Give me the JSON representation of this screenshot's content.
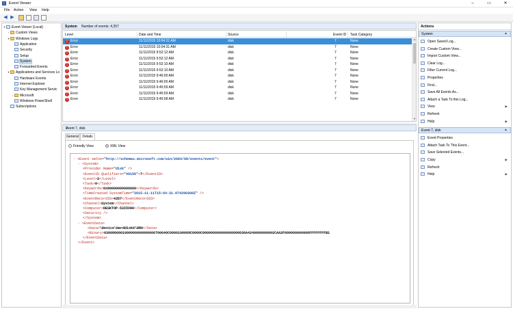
{
  "window": {
    "title": "Event Viewer",
    "minimize": "–",
    "maximize": "▭",
    "close": "✕"
  },
  "menu": [
    "File",
    "Action",
    "View",
    "Help"
  ],
  "toolbar_icons": [
    "back-arrow-icon",
    "forward-arrow-icon",
    "folder-icon",
    "properties-icon",
    "help-icon",
    "console-icon"
  ],
  "tree": [
    {
      "label": "Event Viewer (Local)",
      "indent": 0,
      "exp": "▾",
      "icon": "log"
    },
    {
      "label": "Custom Views",
      "indent": 1,
      "exp": "›",
      "icon": "folder"
    },
    {
      "label": "Windows Logs",
      "indent": 1,
      "exp": "▾",
      "icon": "folder"
    },
    {
      "label": "Application",
      "indent": 2,
      "exp": "",
      "icon": "log"
    },
    {
      "label": "Security",
      "indent": 2,
      "exp": "",
      "icon": "log"
    },
    {
      "label": "Setup",
      "indent": 2,
      "exp": "",
      "icon": "log"
    },
    {
      "label": "System",
      "indent": 2,
      "exp": "",
      "icon": "log",
      "selected": true
    },
    {
      "label": "Forwarded Events",
      "indent": 2,
      "exp": "",
      "icon": "log"
    },
    {
      "label": "Applications and Services Lo",
      "indent": 1,
      "exp": "▾",
      "icon": "folder"
    },
    {
      "label": "Hardware Events",
      "indent": 2,
      "exp": "",
      "icon": "log"
    },
    {
      "label": "Internet Explorer",
      "indent": 2,
      "exp": "",
      "icon": "log"
    },
    {
      "label": "Key Management Servic",
      "indent": 2,
      "exp": "",
      "icon": "log"
    },
    {
      "label": "Microsoft",
      "indent": 2,
      "exp": "›",
      "icon": "folder"
    },
    {
      "label": "Windows PowerShell",
      "indent": 2,
      "exp": "",
      "icon": "log"
    },
    {
      "label": "Subscriptions",
      "indent": 1,
      "exp": "",
      "icon": "log"
    }
  ],
  "list_header": {
    "name": "System",
    "count": "Number of events: 4,357"
  },
  "columns": [
    "Level",
    "Date and Time",
    "Source",
    "Event ID",
    "Task Category"
  ],
  "rows": [
    {
      "level": "Error",
      "date": "11/11/2015 10:04:31 AM",
      "source": "disk",
      "id": "7",
      "task": "None",
      "selected": true
    },
    {
      "level": "Error",
      "date": "11/11/2015 10:04:31 AM",
      "source": "disk",
      "id": "7",
      "task": "None"
    },
    {
      "level": "Error",
      "date": "11/11/2015 9:52:12 AM",
      "source": "disk",
      "id": "7",
      "task": "None"
    },
    {
      "level": "Error",
      "date": "11/11/2015 9:52:12 AM",
      "source": "disk",
      "id": "7",
      "task": "None"
    },
    {
      "level": "Error",
      "date": "11/11/2015 9:52:10 AM",
      "source": "disk",
      "id": "7",
      "task": "None"
    },
    {
      "level": "Error",
      "date": "11/11/2015 9:52:10 AM",
      "source": "disk",
      "id": "7",
      "task": "None"
    },
    {
      "level": "Error",
      "date": "11/11/2015 9:46:00 AM",
      "source": "disk",
      "id": "7",
      "task": "None"
    },
    {
      "level": "Error",
      "date": "11/11/2015 9:46:00 AM",
      "source": "disk",
      "id": "7",
      "task": "None"
    },
    {
      "level": "Error",
      "date": "11/11/2015 9:45:59 AM",
      "source": "disk",
      "id": "7",
      "task": "None"
    },
    {
      "level": "Error",
      "date": "11/11/2015 9:45:59 AM",
      "source": "disk",
      "id": "7",
      "task": "None"
    },
    {
      "level": "Error",
      "date": "11/11/2015 9:45:58 AM",
      "source": "disk",
      "id": "7",
      "task": "None"
    }
  ],
  "detail": {
    "title": "Event 7, disk",
    "close": "✕",
    "tabs": [
      "General",
      "Details"
    ],
    "radio_friendly": "Friendly View",
    "radio_xml": "XML View"
  },
  "xml_lines": [
    {
      "indent": 0,
      "parts": [
        [
          "minus",
          "- "
        ],
        [
          "tag",
          "<Event xmlns="
        ],
        [
          "val",
          "\"http://schemas.microsoft.com/win/2004/08/events/event\""
        ],
        [
          "tag",
          ">"
        ]
      ]
    },
    {
      "indent": 1,
      "parts": [
        [
          "minus",
          "- "
        ],
        [
          "tag",
          "<System>"
        ]
      ]
    },
    {
      "indent": 2,
      "parts": [
        [
          "tag",
          "<Provider Name="
        ],
        [
          "val",
          "\"disk\""
        ],
        [
          "tag",
          " />"
        ]
      ]
    },
    {
      "indent": 2,
      "parts": [
        [
          "tag",
          "<EventID Qualifiers="
        ],
        [
          "val",
          "\"49156\""
        ],
        [
          "tag",
          ">"
        ],
        [
          "txt",
          "7"
        ],
        [
          "tag",
          "</EventID>"
        ]
      ]
    },
    {
      "indent": 2,
      "parts": [
        [
          "tag",
          "<Level>"
        ],
        [
          "txt",
          "2"
        ],
        [
          "tag",
          "</Level>"
        ]
      ]
    },
    {
      "indent": 2,
      "parts": [
        [
          "tag",
          "<Task>"
        ],
        [
          "txt",
          "0"
        ],
        [
          "tag",
          "</Task>"
        ]
      ]
    },
    {
      "indent": 2,
      "parts": [
        [
          "tag",
          "<Keywords>"
        ],
        [
          "txt",
          "0x80000000000000"
        ],
        [
          "tag",
          "</Keywords>"
        ]
      ]
    },
    {
      "indent": 2,
      "parts": [
        [
          "tag",
          "<TimeCreated SystemTime="
        ],
        [
          "val",
          "\"2015-11-11T15:04:31.874290300Z\""
        ],
        [
          "tag",
          " />"
        ]
      ]
    },
    {
      "indent": 2,
      "parts": [
        [
          "tag",
          "<EventRecordID>"
        ],
        [
          "txt",
          "4357"
        ],
        [
          "tag",
          "</EventRecordID>"
        ]
      ]
    },
    {
      "indent": 2,
      "parts": [
        [
          "tag",
          "<Channel>"
        ],
        [
          "txt",
          "System"
        ],
        [
          "tag",
          "</Channel>"
        ]
      ]
    },
    {
      "indent": 2,
      "parts": [
        [
          "tag",
          "<Computer>"
        ],
        [
          "txt",
          "DESKTOP-53I5VH0"
        ],
        [
          "tag",
          "</Computer>"
        ]
      ]
    },
    {
      "indent": 2,
      "parts": [
        [
          "tag",
          "<Security />"
        ]
      ]
    },
    {
      "indent": 2,
      "parts": [
        [
          "tag",
          "</System>"
        ]
      ]
    },
    {
      "indent": 1,
      "parts": [
        [
          "minus",
          "- "
        ],
        [
          "tag",
          "<EventData>"
        ]
      ]
    },
    {
      "indent": 3,
      "parts": [
        [
          "tag",
          "<Data>"
        ],
        [
          "txt",
          "\\Device\\Harddisk0\\DR0"
        ],
        [
          "tag",
          "</Data>"
        ]
      ]
    },
    {
      "indent": 3,
      "parts": [
        [
          "tag",
          "<Binary>"
        ],
        [
          "txt",
          "0300800001000000000000000700040C0000100009C0000C000000000000000000036A4240000000002CAA2F000000000000FFFFFFFFB1"
        ]
      ]
    },
    {
      "indent": 2,
      "parts": [
        [
          "tag",
          "</EventData>"
        ]
      ]
    },
    {
      "indent": 1,
      "parts": [
        [
          "tag",
          "</Event>"
        ]
      ]
    }
  ],
  "actions": {
    "title": "Actions",
    "sections": [
      {
        "title": "System",
        "items": [
          {
            "label": "Open Saved Log...",
            "arrow": false
          },
          {
            "label": "Create Custom View...",
            "arrow": false
          },
          {
            "label": "Import Custom View...",
            "arrow": false
          },
          {
            "label": "Clear Log...",
            "arrow": false
          },
          {
            "label": "Filter Current Log...",
            "arrow": false
          },
          {
            "label": "Properties",
            "arrow": false
          },
          {
            "label": "Find...",
            "arrow": false
          },
          {
            "label": "Save All Events As...",
            "arrow": false
          },
          {
            "label": "Attach a Task To this Log...",
            "arrow": false
          },
          {
            "label": "View",
            "arrow": true
          },
          {
            "label": "Refresh",
            "arrow": false
          },
          {
            "label": "Help",
            "arrow": true
          }
        ]
      },
      {
        "title": "Event 7, disk",
        "items": [
          {
            "label": "Event Properties",
            "arrow": false
          },
          {
            "label": "Attach Task To This Event...",
            "arrow": false
          },
          {
            "label": "Save Selected Events...",
            "arrow": false
          },
          {
            "label": "Copy",
            "arrow": true
          },
          {
            "label": "Refresh",
            "arrow": false
          },
          {
            "label": "Help",
            "arrow": true
          }
        ]
      }
    ]
  },
  "colors": {
    "selection": "#3a8fd6",
    "error": "#c9241f",
    "xml_tag": "#b8261d",
    "xml_value": "#1a4fb0"
  }
}
